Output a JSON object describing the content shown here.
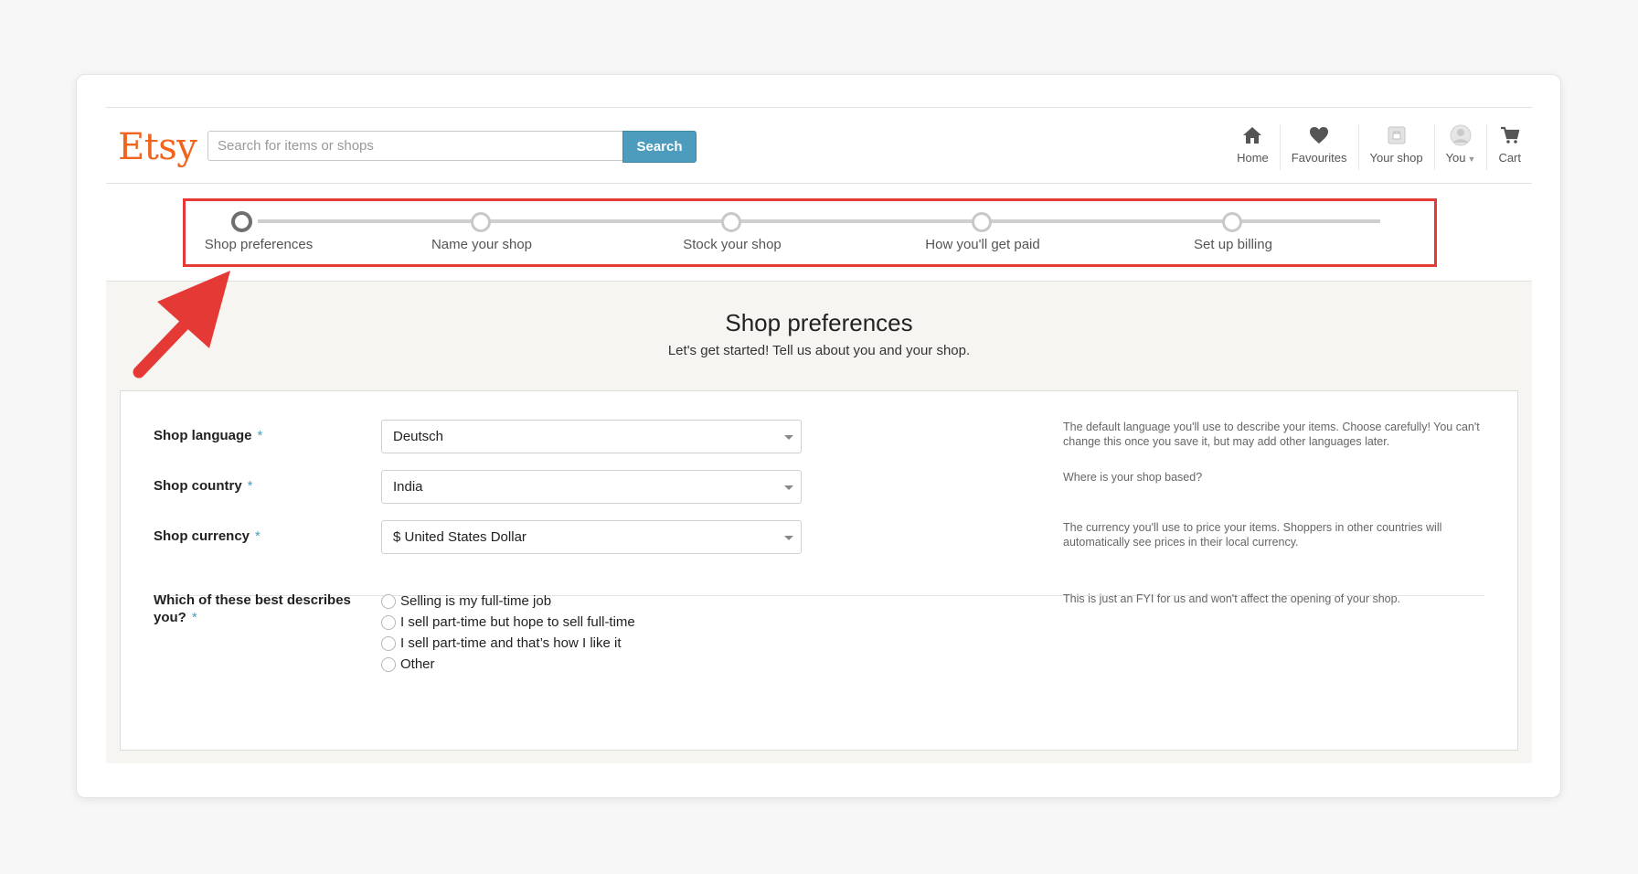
{
  "header": {
    "logo": "Etsy",
    "search_placeholder": "Search for items or shops",
    "search_button": "Search",
    "nav": [
      {
        "label": "Home",
        "icon": "home-icon"
      },
      {
        "label": "Favourites",
        "icon": "heart-icon"
      },
      {
        "label": "Your shop",
        "icon": "shop-icon"
      },
      {
        "label": "You",
        "icon": "avatar-icon"
      },
      {
        "label": "Cart",
        "icon": "cart-icon"
      }
    ]
  },
  "stepper": {
    "steps": [
      "Shop preferences",
      "Name your shop",
      "Stock your shop",
      "How you'll get paid",
      "Set up billing"
    ],
    "active_index": 0,
    "highlight_color": "#e53935"
  },
  "page": {
    "title": "Shop preferences",
    "subtitle": "Let's get started! Tell us about you and your shop."
  },
  "form": {
    "language": {
      "label": "Shop language",
      "value": "Deutsch",
      "help": "The default language you'll use to describe your items. Choose carefully! You can't change this once you save it, but may add other languages later."
    },
    "country": {
      "label": "Shop country",
      "value": "India",
      "help": "Where is your shop based?"
    },
    "currency": {
      "label": "Shop currency",
      "value": "$ United States Dollar",
      "help": "The currency you'll use to price your items. Shoppers in other countries will automatically see prices in their local currency."
    },
    "describes": {
      "label_line1": "Which of these best describes",
      "label_line2": "you?",
      "options": [
        "Selling is my full-time job",
        "I sell part-time but hope to sell full-time",
        "I sell part-time and that’s how I like it",
        "Other"
      ],
      "help": "This is just an FYI for us and won't affect the opening of your shop."
    },
    "required_mark": "*"
  },
  "colors": {
    "brand": "#f1641e",
    "search_button": "#4d9cbd",
    "annotation": "#e53935"
  }
}
